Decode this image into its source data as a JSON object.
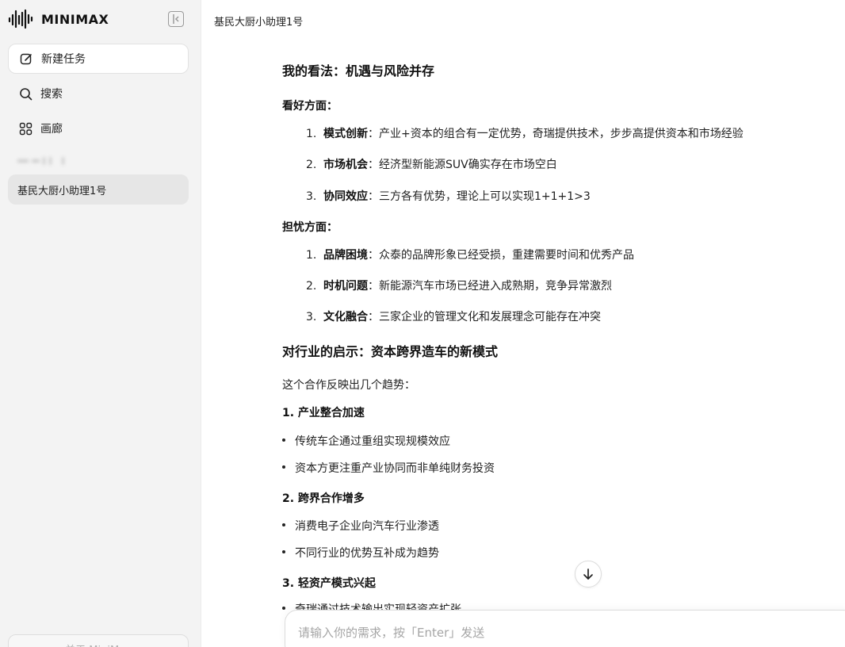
{
  "sidebar": {
    "brand_name": "MINIMAX",
    "nav": {
      "new_task": "新建任务",
      "search": "搜索",
      "gallery": "画廊"
    },
    "history_item": "基民大厨小助理1号",
    "footer": "关于 MiniMax"
  },
  "main": {
    "chat_title": "基民大厨小助理1号",
    "content": {
      "heading1": "我的看法：机遇与风险并存",
      "pros_title": "看好方面：",
      "pros": [
        {
          "num": "1.",
          "term": "模式创新",
          "text": "：产业+资本的组合有一定优势，奇瑞提供技术，步步高提供资本和市场经验"
        },
        {
          "num": "2.",
          "term": "市场机会",
          "text": "：经济型新能源SUV确实存在市场空白"
        },
        {
          "num": "3.",
          "term": "协同效应",
          "text": "：三方各有优势，理论上可以实现1+1+1>3"
        }
      ],
      "cons_title": "担忧方面：",
      "cons": [
        {
          "num": "1.",
          "term": "品牌困境",
          "text": "：众泰的品牌形象已经受损，重建需要时间和优秀产品"
        },
        {
          "num": "2.",
          "term": "时机问题",
          "text": "：新能源汽车市场已经进入成熟期，竞争异常激烈"
        },
        {
          "num": "3.",
          "term": "文化融合",
          "text": "：三家企业的管理文化和发展理念可能存在冲突"
        }
      ],
      "heading2": "对行业的启示：资本跨界造车的新模式",
      "trends_intro": "这个合作反映出几个趋势：",
      "trend1_title": "1. 产业整合加速",
      "trend1_items": [
        "传统车企通过重组实现规模效应",
        "资本方更注重产业协同而非单纯财务投资"
      ],
      "trend2_title": "2. 跨界合作增多",
      "trend2_items": [
        "消费电子企业向汽车行业渗透",
        "不同行业的优势互补成为趋势"
      ],
      "trend3_title": "3. 轻资产模式兴起",
      "trend3_partial": "奇瑞通过技术输出实现轻资产扩张"
    },
    "input": {
      "placeholder": "请输入你的需求，按「Enter」发送"
    }
  }
}
